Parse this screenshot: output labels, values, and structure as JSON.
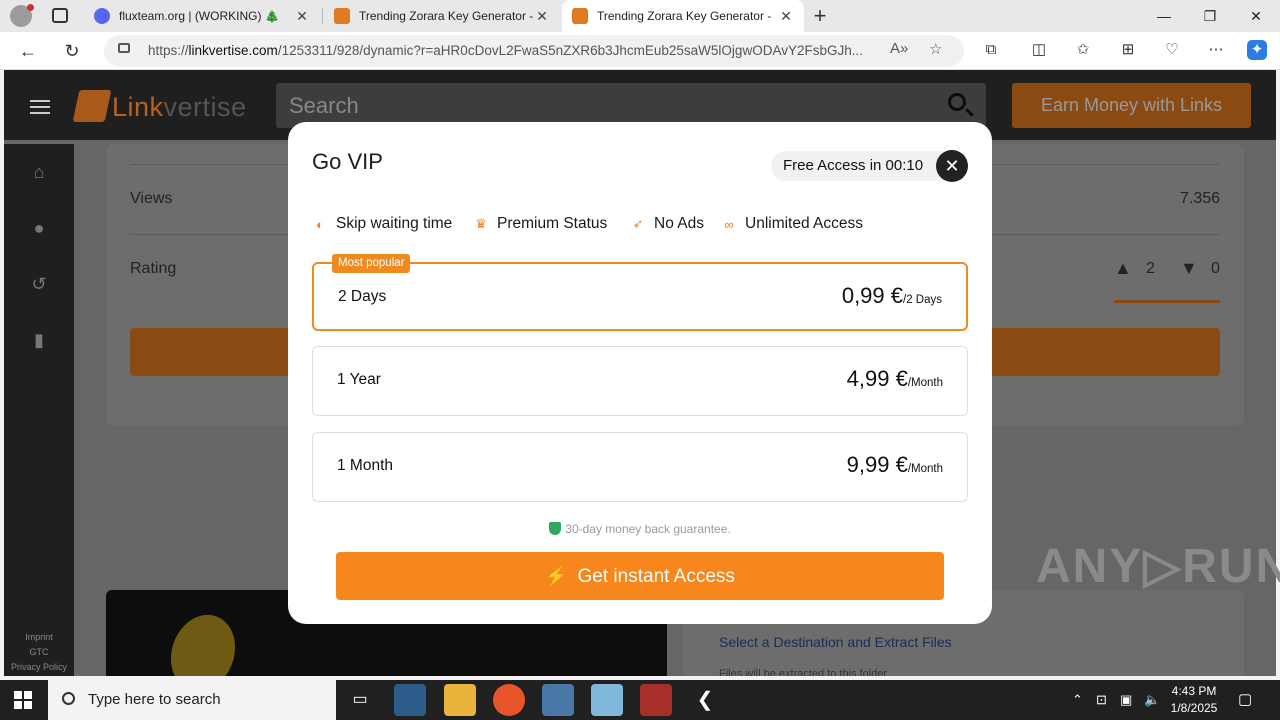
{
  "browser": {
    "tabs": [
      {
        "title": "fluxteam.org | (WORKING) 🎄",
        "active": false
      },
      {
        "title": "Trending Zorara Key Generator - ",
        "active": false
      },
      {
        "title": "Trending Zorara Key Generator - ",
        "active": true
      }
    ],
    "url_prefix": "https://",
    "url_domain": "linkvertise.com",
    "url_rest": "/1253311/928/dynamic?r=aHR0cDovL2FwaS5nZXR6b3JhcmEub25saW5lOjgwODAvY2FsbGJh..."
  },
  "site": {
    "logo_a": "Link",
    "logo_b": "vertise",
    "search_placeholder": "Search",
    "earn_button": "Earn Money with Links",
    "footer": [
      "Imprint",
      "GTC",
      "Privacy Policy"
    ],
    "rows": [
      {
        "label": "Views",
        "value": "7.356"
      },
      {
        "label": "Rating",
        "likes": "2",
        "dislikes": "0"
      }
    ],
    "promo_title": "Select a Destination and Extract Files",
    "promo_sub": "Files will be extracted to this folder"
  },
  "modal": {
    "title": "Go VIP",
    "free_access": "Free Access in 00:10",
    "features": [
      "Skip waiting time",
      "Premium Status",
      "No Ads",
      "Unlimited Access"
    ],
    "badge": "Most popular",
    "plans": [
      {
        "name": "2 Days",
        "price": "0,99 €",
        "period": "/2 Days",
        "selected": true
      },
      {
        "name": "1 Year",
        "price": "4,99 €",
        "period": "/Month",
        "selected": false
      },
      {
        "name": "1 Month",
        "price": "9,99 €",
        "period": "/Month",
        "selected": false
      }
    ],
    "guarantee": "30-day money back guarantee.",
    "cta": "Get instant Access"
  },
  "watermark": "ANY▷RUN",
  "taskbar": {
    "search_placeholder": "Type here to search",
    "time": "4:43 PM",
    "date": "1/8/2025"
  },
  "colors": {
    "accent": "#f7861c",
    "guarantee": "#2fa85a"
  }
}
